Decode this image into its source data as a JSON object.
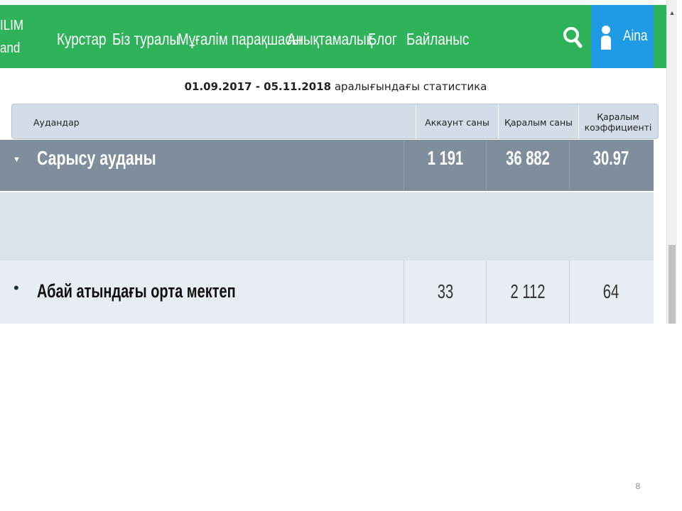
{
  "header": {
    "logo_top": "ILIM",
    "logo_bottom": "and",
    "nav_items": [
      "Курстар",
      "Біз туралы",
      "Мұғалім парақшасы",
      "Анықтамалық",
      "Блог",
      "Байланыс"
    ],
    "user_name": "Aina",
    "icons": [
      "search-icon",
      "user-icon"
    ],
    "colors": {
      "bar": "#2fb35a",
      "user_box": "#1e9be4"
    }
  },
  "stats": {
    "date_range": "01.09.2017 - 05.11.2018",
    "title_suffix": "аралығындағы статистика",
    "columns": {
      "districts": "Аудандар",
      "accounts": "Аккаунт саны",
      "views": "Қаралым саны",
      "coef_line1": "Қаралым",
      "coef_line2": "коэффициенті"
    }
  },
  "rows": {
    "district": {
      "marker": "▼",
      "name": "Сарысу ауданы",
      "accounts": "1 191",
      "views": "36 882",
      "coefficient": "30.97"
    },
    "school": {
      "marker": "•",
      "name": "Абай атындағы орта мектеп",
      "accounts": "33",
      "views": "2 112",
      "coefficient": "64"
    }
  },
  "scrollbar": {
    "up_arrow": "▲"
  },
  "slide": {
    "page_number": "8"
  }
}
